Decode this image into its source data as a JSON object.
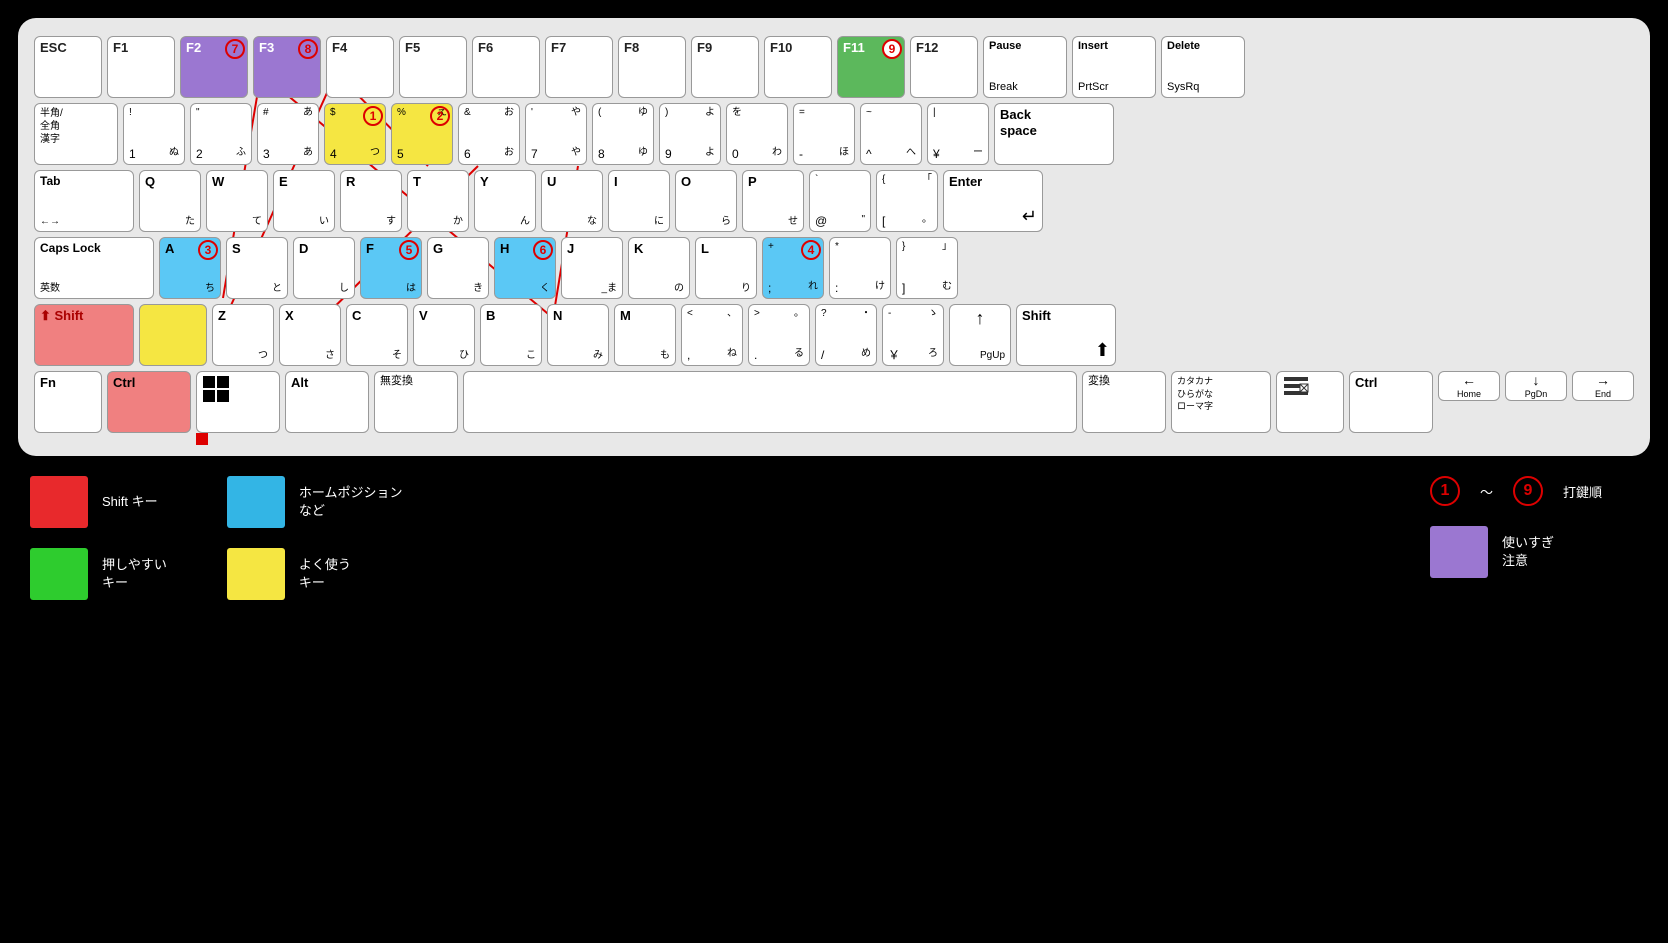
{
  "keyboard": {
    "rows": [
      {
        "id": "row-function",
        "keys": [
          {
            "id": "esc",
            "label": "ESC",
            "sub": "",
            "width": "normal",
            "color": "white"
          },
          {
            "id": "f1",
            "label": "F1",
            "sub": "",
            "width": "normal",
            "color": "white"
          },
          {
            "id": "f2",
            "label": "F2",
            "sub": "",
            "width": "normal",
            "color": "purple",
            "annotation": "7"
          },
          {
            "id": "f3",
            "label": "F3",
            "sub": "",
            "width": "normal",
            "color": "purple",
            "annotation": "8"
          },
          {
            "id": "f4",
            "label": "F4",
            "sub": "",
            "width": "normal",
            "color": "white"
          },
          {
            "id": "f5",
            "label": "F5",
            "sub": "",
            "width": "normal",
            "color": "white"
          },
          {
            "id": "f6",
            "label": "F6",
            "sub": "",
            "width": "normal",
            "color": "white"
          },
          {
            "id": "f7",
            "label": "F7",
            "sub": "",
            "width": "normal",
            "color": "white"
          },
          {
            "id": "f8",
            "label": "F8",
            "sub": "",
            "width": "normal",
            "color": "white"
          },
          {
            "id": "f9",
            "label": "F9",
            "sub": "",
            "width": "normal",
            "color": "white"
          },
          {
            "id": "f10",
            "label": "F10",
            "sub": "",
            "width": "normal",
            "color": "white"
          },
          {
            "id": "f11",
            "label": "F11",
            "sub": "",
            "width": "normal",
            "color": "green",
            "annotation": "9"
          },
          {
            "id": "f12",
            "label": "F12",
            "sub": "",
            "width": "normal",
            "color": "white"
          },
          {
            "id": "pause",
            "label": "Pause\nBreak",
            "sub": "",
            "width": "wide",
            "color": "white"
          },
          {
            "id": "insert",
            "label": "Insert\nPrtScr",
            "sub": "",
            "width": "wide",
            "color": "white"
          },
          {
            "id": "delete",
            "label": "Delete\nSysRq",
            "sub": "",
            "width": "wide",
            "color": "white"
          }
        ]
      }
    ],
    "annotations": {
      "1": {
        "key": "num4",
        "label": "①"
      },
      "2": {
        "key": "num5",
        "label": "②"
      },
      "3": {
        "key": "a",
        "label": "③"
      },
      "4": {
        "key": "plus",
        "label": "④"
      },
      "5": {
        "key": "f",
        "label": "⑤"
      },
      "6": {
        "key": "h",
        "label": "⑥"
      },
      "7": {
        "key": "f2",
        "label": "⑦"
      },
      "8": {
        "key": "f3",
        "label": "⑧"
      },
      "9": {
        "key": "f11",
        "label": "⑨"
      }
    }
  },
  "legend": {
    "colors": [
      {
        "id": "red",
        "hex": "#e8292c",
        "label": "Shift キー"
      },
      {
        "id": "blue",
        "hex": "#33b5e5",
        "label": "ホームポジション\nなど"
      },
      {
        "id": "green",
        "hex": "#2ecc2e",
        "label": "押しやすい\nキー"
      },
      {
        "id": "yellow",
        "hex": "#f5e642",
        "label": "よく使う\nキー"
      },
      {
        "id": "purple",
        "hex": "#9b77d1",
        "label": "使いすぎ\n注意"
      }
    ],
    "num_range": {
      "from": "①",
      "to": "⑨",
      "label": "打鍵順"
    }
  }
}
